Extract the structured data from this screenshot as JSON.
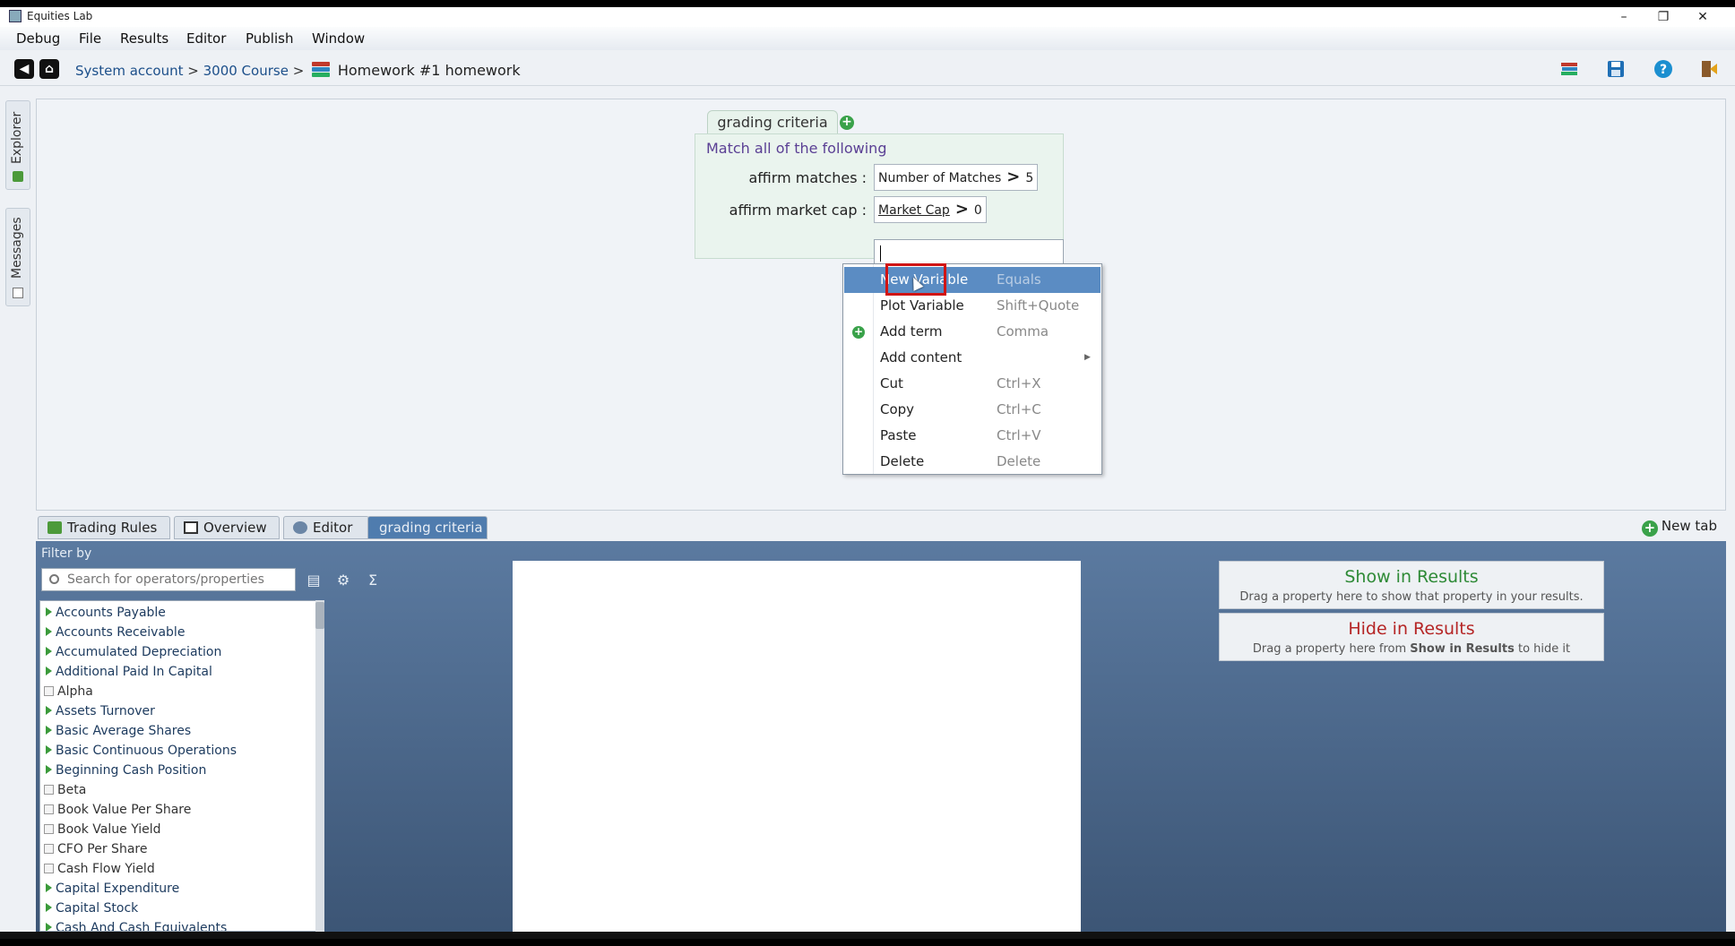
{
  "window": {
    "title": "Equities Lab",
    "minimize": "–",
    "maximize": "❐",
    "close": "✕"
  },
  "menu": [
    "Debug",
    "File",
    "Results",
    "Editor",
    "Publish",
    "Window"
  ],
  "breadcrumb": {
    "part1": "System account",
    "sep": ">",
    "part2": "3000 Course",
    "current": "Homework #1 homework"
  },
  "side_tabs": {
    "explorer": "Explorer",
    "messages": "Messages"
  },
  "criteria": {
    "tab_label": "grading criteria",
    "header": "Match all of the following",
    "rules": [
      {
        "label": "affirm matches :",
        "field": "Number of Matches",
        "op": ">",
        "value": "5"
      },
      {
        "label": "affirm market cap :",
        "field": "Market Cap",
        "op": ">",
        "value": "0"
      }
    ]
  },
  "context_menu": [
    {
      "label": "New Variable",
      "shortcut": "Equals",
      "highlight": true
    },
    {
      "label": "Plot Variable",
      "shortcut": "Shift+Quote"
    },
    {
      "label": "Add term",
      "shortcut": "Comma",
      "icon": "add-icon"
    },
    {
      "label": "Add content",
      "shortcut": "",
      "submenu": true
    },
    {
      "label": "Cut",
      "shortcut": "Ctrl+X"
    },
    {
      "label": "Copy",
      "shortcut": "Ctrl+C"
    },
    {
      "label": "Paste",
      "shortcut": "Ctrl+V"
    },
    {
      "label": "Delete",
      "shortcut": "Delete"
    }
  ],
  "bottom_tabs": [
    "Trading Rules",
    "Overview",
    "Editor",
    "grading criteria"
  ],
  "new_tab": "New tab",
  "filter": {
    "label": "Filter by",
    "search_placeholder": "Search for operators/properties",
    "sigma": "Σ"
  },
  "properties": [
    {
      "name": "Accounts Payable",
      "expandable": true
    },
    {
      "name": "Accounts Receivable",
      "expandable": true
    },
    {
      "name": "Accumulated Depreciation",
      "expandable": true
    },
    {
      "name": "Additional Paid In Capital",
      "expandable": true
    },
    {
      "name": "Alpha",
      "expandable": false
    },
    {
      "name": "Assets Turnover",
      "expandable": true
    },
    {
      "name": "Basic Average Shares",
      "expandable": true
    },
    {
      "name": "Basic Continuous Operations",
      "expandable": true
    },
    {
      "name": "Beginning Cash Position",
      "expandable": true
    },
    {
      "name": "Beta",
      "expandable": false
    },
    {
      "name": "Book Value Per Share",
      "expandable": false
    },
    {
      "name": "Book Value Yield",
      "expandable": false
    },
    {
      "name": "CFO Per Share",
      "expandable": false
    },
    {
      "name": "Cash Flow Yield",
      "expandable": false
    },
    {
      "name": "Capital Expenditure",
      "expandable": true
    },
    {
      "name": "Capital Stock",
      "expandable": true
    },
    {
      "name": "Cash And Cash Equivalents",
      "expandable": true
    }
  ],
  "results": {
    "show_title": "Show in Results",
    "show_sub": "Drag a property here to show that property in your results.",
    "hide_title": "Hide in Results",
    "hide_sub_pre": "Drag a property here from ",
    "hide_sub_bold": "Show in Results",
    "hide_sub_post": " to hide it"
  },
  "colors": {
    "accent": "#4f7cae",
    "add": "#3aa24a",
    "highlight_box": "#d01414"
  }
}
